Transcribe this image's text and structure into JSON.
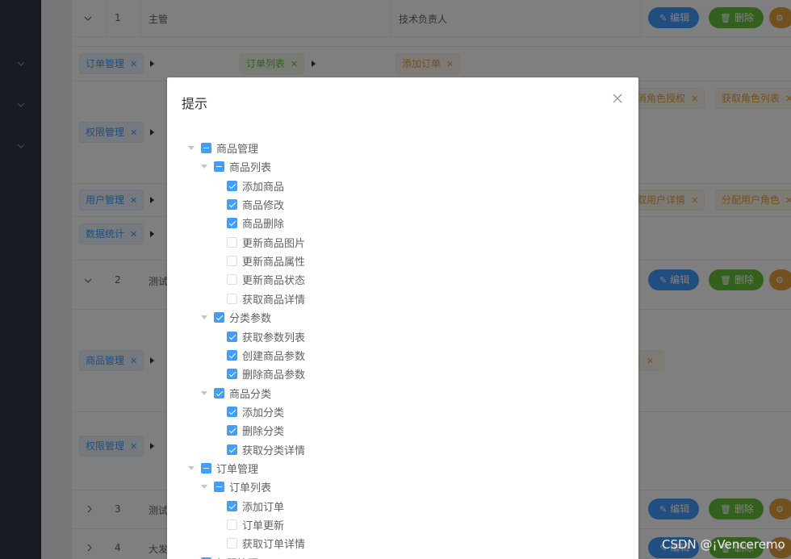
{
  "table": {
    "rows": [
      {
        "index": "1",
        "name": "主管",
        "desc": "技术负责人"
      },
      {
        "index": "2",
        "name": "测试"
      },
      {
        "index": "3",
        "name": "测试"
      },
      {
        "index": "4",
        "name": "大发"
      }
    ],
    "actions": {
      "edit": "编辑",
      "delete": "删除"
    },
    "row1_tags": {
      "l1": [
        "订单管理",
        "权限管理",
        "用户管理",
        "数据统计"
      ],
      "l2": [
        "订单列表"
      ],
      "l3": [
        "添加订单",
        "取消角色授权",
        "获取角色列表",
        "获取用户详情",
        "分配用户角色"
      ]
    },
    "row2_tags": {
      "l1": [
        "商品管理",
        "权限管理"
      ]
    }
  },
  "dialog": {
    "title": "提示",
    "tree": [
      {
        "label": "商品管理",
        "level": 0,
        "state": "indeterminate",
        "expandable": true
      },
      {
        "label": "商品列表",
        "level": 1,
        "state": "indeterminate",
        "expandable": true
      },
      {
        "label": "添加商品",
        "level": 2,
        "state": "checked"
      },
      {
        "label": "商品修改",
        "level": 2,
        "state": "checked"
      },
      {
        "label": "商品删除",
        "level": 2,
        "state": "checked"
      },
      {
        "label": "更新商品图片",
        "level": 2,
        "state": "unchecked"
      },
      {
        "label": "更新商品属性",
        "level": 2,
        "state": "unchecked"
      },
      {
        "label": "更新商品状态",
        "level": 2,
        "state": "unchecked"
      },
      {
        "label": "获取商品详情",
        "level": 2,
        "state": "unchecked"
      },
      {
        "label": "分类参数",
        "level": 1,
        "state": "checked",
        "expandable": true
      },
      {
        "label": "获取参数列表",
        "level": 2,
        "state": "checked"
      },
      {
        "label": "创建商品参数",
        "level": 2,
        "state": "checked"
      },
      {
        "label": "删除商品参数",
        "level": 2,
        "state": "checked"
      },
      {
        "label": "商品分类",
        "level": 1,
        "state": "checked",
        "expandable": true
      },
      {
        "label": "添加分类",
        "level": 2,
        "state": "checked"
      },
      {
        "label": "删除分类",
        "level": 2,
        "state": "checked"
      },
      {
        "label": "获取分类详情",
        "level": 2,
        "state": "checked"
      },
      {
        "label": "订单管理",
        "level": 0,
        "state": "indeterminate",
        "expandable": true
      },
      {
        "label": "订单列表",
        "level": 1,
        "state": "indeterminate",
        "expandable": true
      },
      {
        "label": "添加订单",
        "level": 2,
        "state": "checked"
      },
      {
        "label": "订单更新",
        "level": 2,
        "state": "unchecked"
      },
      {
        "label": "获取订单详情",
        "level": 2,
        "state": "unchecked"
      },
      {
        "label": "权限管理",
        "level": 0,
        "state": "indeterminate",
        "expandable": true
      }
    ]
  },
  "watermark": "CSDN @¡Venceremo"
}
